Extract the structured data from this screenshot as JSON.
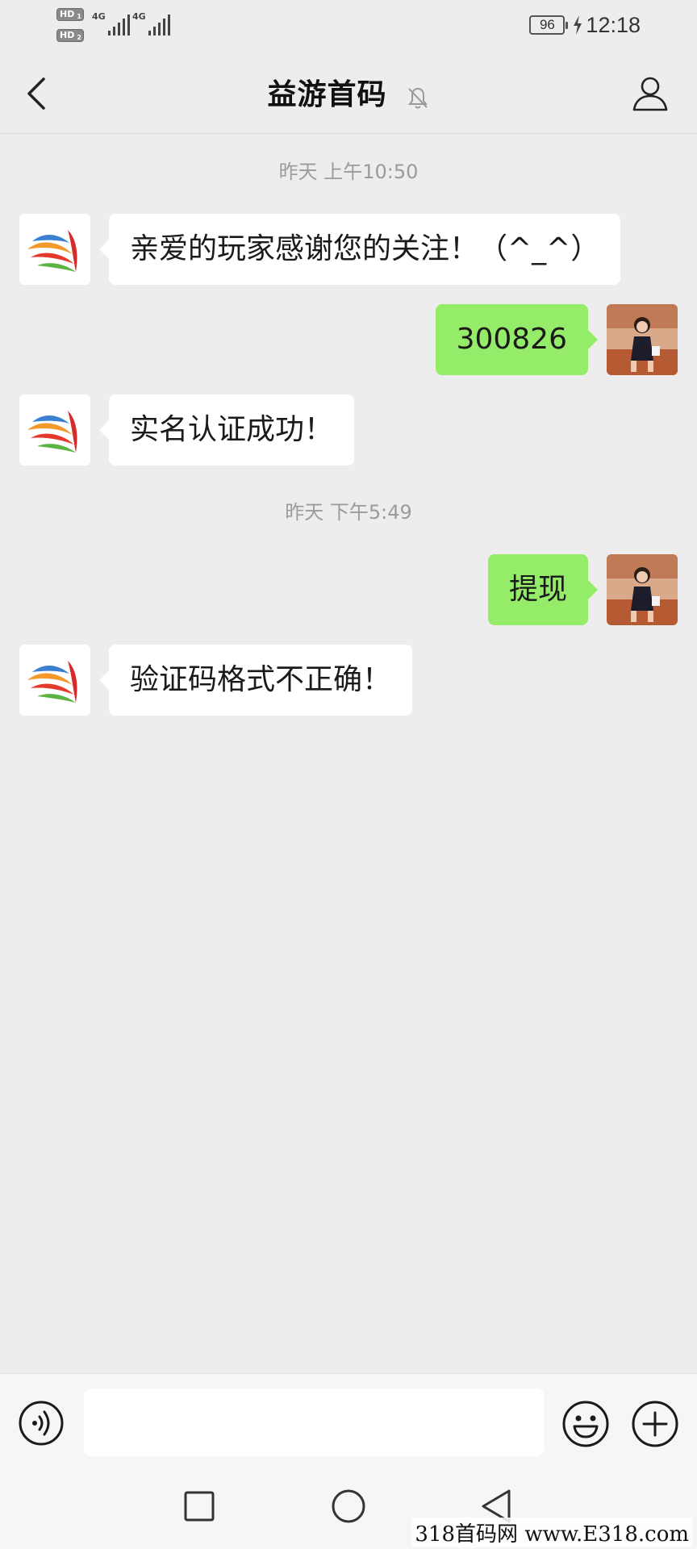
{
  "status_bar": {
    "sim1_label": "HD",
    "sim1_sub": "1",
    "sim2_label": "HD",
    "sim2_sub": "2",
    "network1": "4G",
    "network2": "4G",
    "battery": "96",
    "time": "12:18"
  },
  "header": {
    "title": "益游首码"
  },
  "messages": [
    {
      "type": "timestamp",
      "text": "昨天 上午10:50"
    },
    {
      "type": "incoming",
      "text": "亲爱的玩家感谢您的关注！（^_^）"
    },
    {
      "type": "outgoing",
      "text": "300826"
    },
    {
      "type": "incoming",
      "text": "实名认证成功！"
    },
    {
      "type": "timestamp",
      "text": "昨天 下午5:49"
    },
    {
      "type": "outgoing",
      "text": "提现"
    },
    {
      "type": "incoming",
      "text": "验证码格式不正确！"
    }
  ],
  "input": {
    "value": ""
  },
  "watermark": "318首码网 www.E318.com",
  "colors": {
    "background": "#ededed",
    "outgoing_bubble": "#95ec69",
    "incoming_bubble": "#ffffff",
    "timestamp_text": "#9b9b9b"
  },
  "icons": {
    "back": "chevron-left-icon",
    "mute": "bell-off-icon",
    "profile": "person-icon",
    "voice": "voice-icon",
    "emoji": "smiley-icon",
    "plus": "plus-icon",
    "nav_recent": "square-icon",
    "nav_home": "circle-icon",
    "nav_back": "triangle-back-icon"
  }
}
